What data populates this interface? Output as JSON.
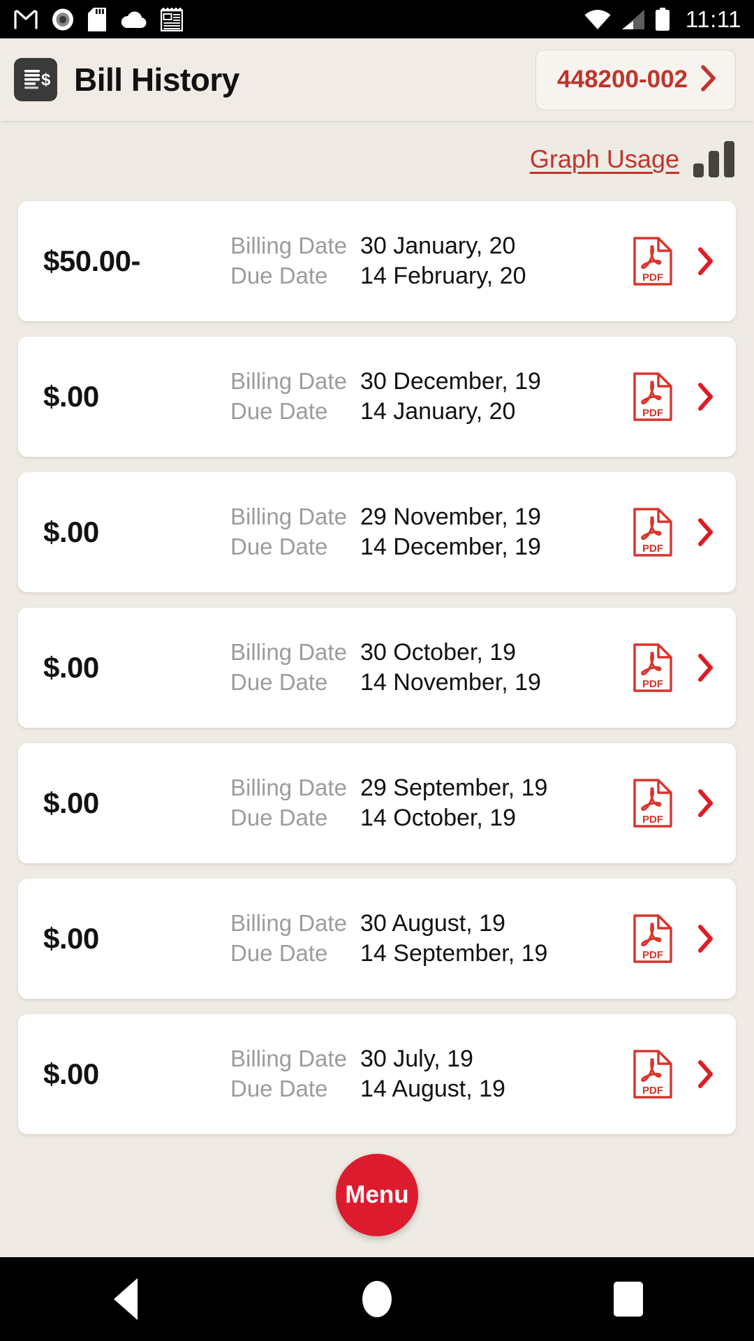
{
  "statusbar": {
    "icons": [
      "gmail-m-icon",
      "record-dot-icon",
      "sd-card-icon",
      "cloud-icon",
      "news-notepad-icon"
    ],
    "wifi_icon": "wifi-icon",
    "signal_icon": "cell-signal-icon",
    "battery_icon": "battery-full-icon",
    "time": "11:11"
  },
  "header": {
    "app_icon": "bill-document-icon",
    "title": "Bill History",
    "account": {
      "number": "448200-002",
      "chevron_icon": "chevron-right-icon"
    }
  },
  "usage": {
    "link_label": "Graph Usage",
    "chart_icon": "bar-chart-icon"
  },
  "labels": {
    "billing_date": "Billing Date",
    "due_date": "Due Date",
    "pdf_icon": "pdf-file-icon",
    "pdf_text": "PDF",
    "row_chevron_icon": "chevron-right-icon"
  },
  "bills": [
    {
      "amount": "$50.00-",
      "billing_date": "30 January, 20",
      "due_date": "14 February, 20"
    },
    {
      "amount": "$.00",
      "billing_date": "30 December, 19",
      "due_date": "14 January, 20"
    },
    {
      "amount": "$.00",
      "billing_date": "29 November, 19",
      "due_date": "14 December, 19"
    },
    {
      "amount": "$.00",
      "billing_date": "30 October, 19",
      "due_date": "14 November, 19"
    },
    {
      "amount": "$.00",
      "billing_date": "29 September, 19",
      "due_date": "14 October, 19"
    },
    {
      "amount": "$.00",
      "billing_date": "30 August, 19",
      "due_date": "14 September, 19"
    },
    {
      "amount": "$.00",
      "billing_date": "30 July, 19",
      "due_date": "14 August, 19"
    }
  ],
  "fab": {
    "label": "Menu"
  },
  "navbar": {
    "back_icon": "nav-back-icon",
    "home_icon": "nav-home-icon",
    "recents_icon": "nav-recents-icon"
  },
  "colors": {
    "brand_red": "#C0342C",
    "fab_red": "#DC1C2E",
    "page_bg": "#EFEAE4",
    "card_bg": "#FFFFFF",
    "label_gray": "#9C9C9C"
  }
}
